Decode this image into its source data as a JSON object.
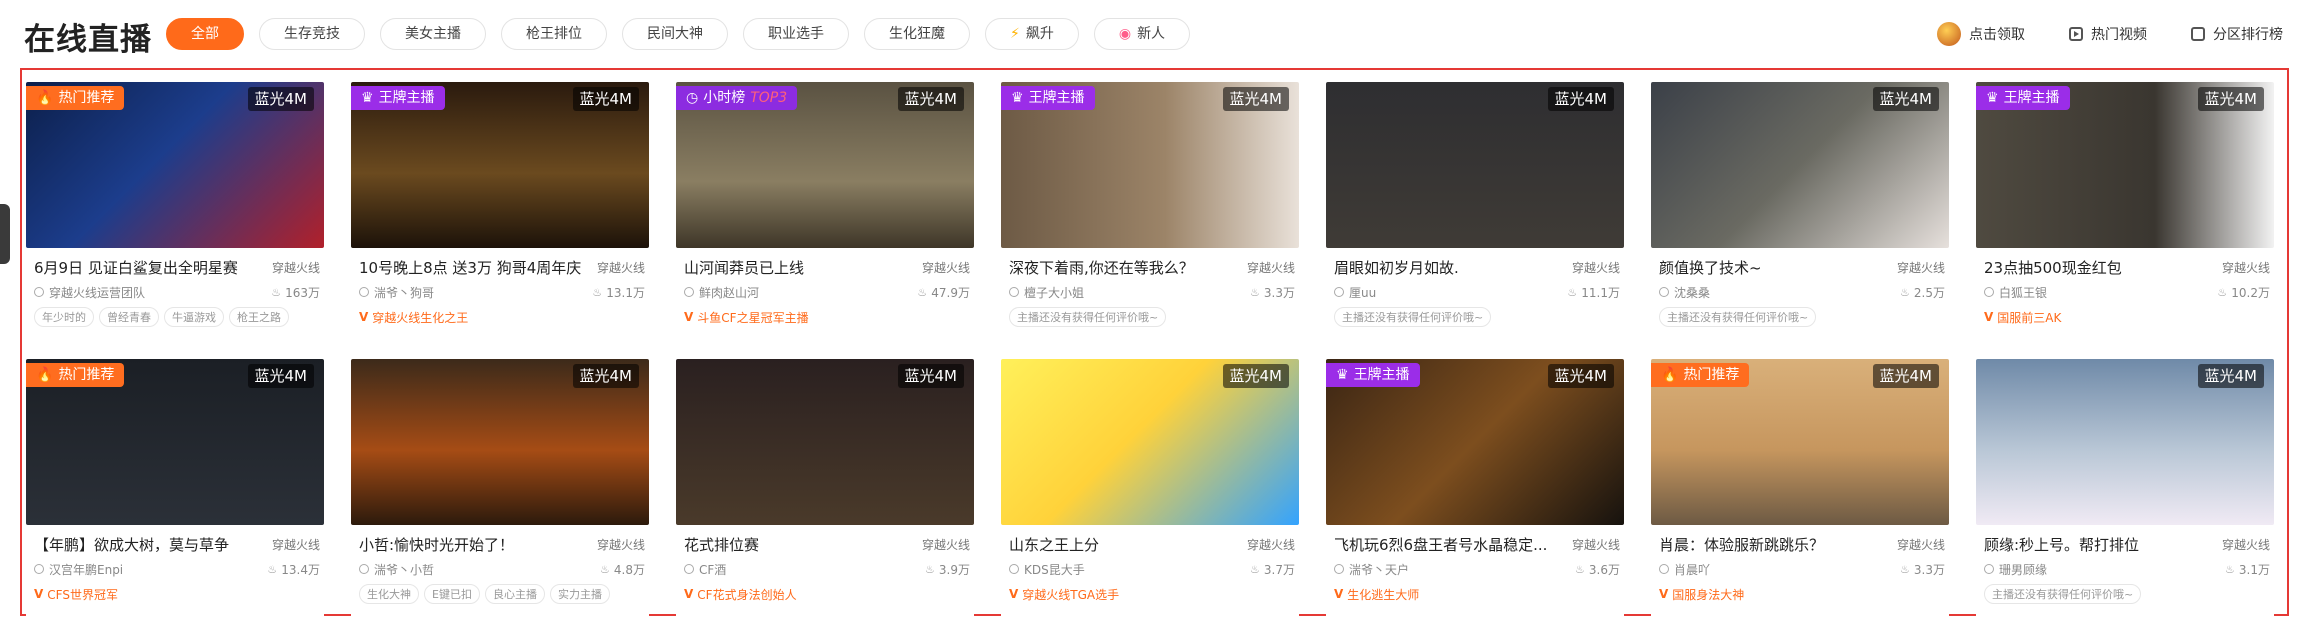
{
  "page_title": "在线直播",
  "filters": [
    {
      "label": "全部",
      "active": true,
      "icon": ""
    },
    {
      "label": "生存竞技",
      "active": false,
      "icon": ""
    },
    {
      "label": "美女主播",
      "active": false,
      "icon": ""
    },
    {
      "label": "枪王排位",
      "active": false,
      "icon": ""
    },
    {
      "label": "民间大神",
      "active": false,
      "icon": ""
    },
    {
      "label": "职业选手",
      "active": false,
      "icon": ""
    },
    {
      "label": "生化狂魔",
      "active": false,
      "icon": ""
    },
    {
      "label": "飙升",
      "active": false,
      "icon": "lightning-icon"
    },
    {
      "label": "新人",
      "active": false,
      "icon": "new-icon"
    }
  ],
  "header_links": {
    "claim": "点击领取",
    "hot_videos": "热门视频",
    "rank": "分区排行榜"
  },
  "colors": {
    "accent": "#ff6a1a",
    "ace_badge": "#9b2de8",
    "frame": "#e53935"
  },
  "quality_label": "蓝光4M",
  "streams": [
    {
      "badge": "热门推荐",
      "badge_type": "hot",
      "title": "6月9日 见证白鲨复出全明星赛",
      "category": "穿越火线",
      "anchor": "穿越火线运营团队",
      "heat": "163万",
      "tags": [
        "年少时的",
        "曾经青春",
        "牛逼游戏",
        "枪王之路"
      ],
      "honor": ""
    },
    {
      "badge": "王牌主播",
      "badge_type": "ace",
      "title": "10号晚上8点 送3万 狗哥4周年庆",
      "category": "穿越火线",
      "anchor": "湍爷丶狗哥",
      "heat": "13.1万",
      "tags": [],
      "honor": "穿越火线生化之王"
    },
    {
      "badge": "小时榜",
      "badge_suffix": "TOP3",
      "badge_type": "top",
      "title": "山河闻莽员已上线",
      "category": "穿越火线",
      "anchor": "鲜肉赵山河",
      "heat": "47.9万",
      "tags": [],
      "honor": "斗鱼CF之星冠军主播"
    },
    {
      "badge": "王牌主播",
      "badge_type": "ace",
      "title": "深夜下着雨,你还在等我么？",
      "category": "穿越火线",
      "anchor": "檀子大小姐",
      "heat": "3.3万",
      "tags": [
        "主播还没有获得任何评价哦~"
      ],
      "honor": ""
    },
    {
      "badge": "",
      "badge_type": "",
      "title": "眉眼如初岁月如故.",
      "category": "穿越火线",
      "anchor": "厘uu",
      "heat": "11.1万",
      "tags": [
        "主播还没有获得任何评价哦~"
      ],
      "honor": ""
    },
    {
      "badge": "",
      "badge_type": "",
      "title": "颜值换了技术~",
      "category": "穿越火线",
      "anchor": "沈桑桑",
      "heat": "2.5万",
      "tags": [
        "主播还没有获得任何评价哦~"
      ],
      "honor": ""
    },
    {
      "badge": "王牌主播",
      "badge_type": "ace",
      "title": "23点抽500现金红包",
      "category": "穿越火线",
      "anchor": "白狐王银",
      "heat": "10.2万",
      "tags": [],
      "honor": "国服前三AK"
    },
    {
      "badge": "热门推荐",
      "badge_type": "hot",
      "title": "【年鹏】欲成大树，莫与草争",
      "category": "穿越火线",
      "anchor": "汉宫年鹏Enpi",
      "heat": "13.4万",
      "tags": [],
      "honor": "CFS世界冠军"
    },
    {
      "badge": "",
      "badge_type": "",
      "title": "小哲:愉快时光开始了！",
      "category": "穿越火线",
      "anchor": "湍爷丶小哲",
      "heat": "4.8万",
      "tags": [
        "生化大神",
        "E键已扣",
        "良心主播",
        "实力主播"
      ],
      "honor": ""
    },
    {
      "badge": "",
      "badge_type": "",
      "title": "花式排位赛",
      "category": "穿越火线",
      "anchor": "CF酒",
      "heat": "3.9万",
      "tags": [],
      "honor": "CF花式身法创始人"
    },
    {
      "badge": "",
      "badge_type": "",
      "title": "山东之王上分",
      "category": "穿越火线",
      "anchor": "KDS昆大手",
      "heat": "3.7万",
      "tags": [],
      "honor": "穿越火线TGA选手"
    },
    {
      "badge": "王牌主播",
      "badge_type": "ace",
      "title": "飞机玩6烈6盘王者号水晶稳定...",
      "category": "穿越火线",
      "anchor": "湍爷丶天户",
      "heat": "3.6万",
      "tags": [],
      "honor": "生化逃生大师"
    },
    {
      "badge": "热门推荐",
      "badge_type": "hot",
      "title": "肖晨：体验服新跳跳乐？",
      "category": "穿越火线",
      "anchor": "肖晨吖",
      "heat": "3.3万",
      "tags": [],
      "honor": "国服身法大神"
    },
    {
      "badge": "",
      "badge_type": "",
      "title": "顾缘:秒上号。帮打排位",
      "category": "穿越火线",
      "anchor": "珊男顾缘",
      "heat": "3.1万",
      "tags": [
        "主播还没有获得任何评价哦~"
      ],
      "honor": ""
    }
  ]
}
